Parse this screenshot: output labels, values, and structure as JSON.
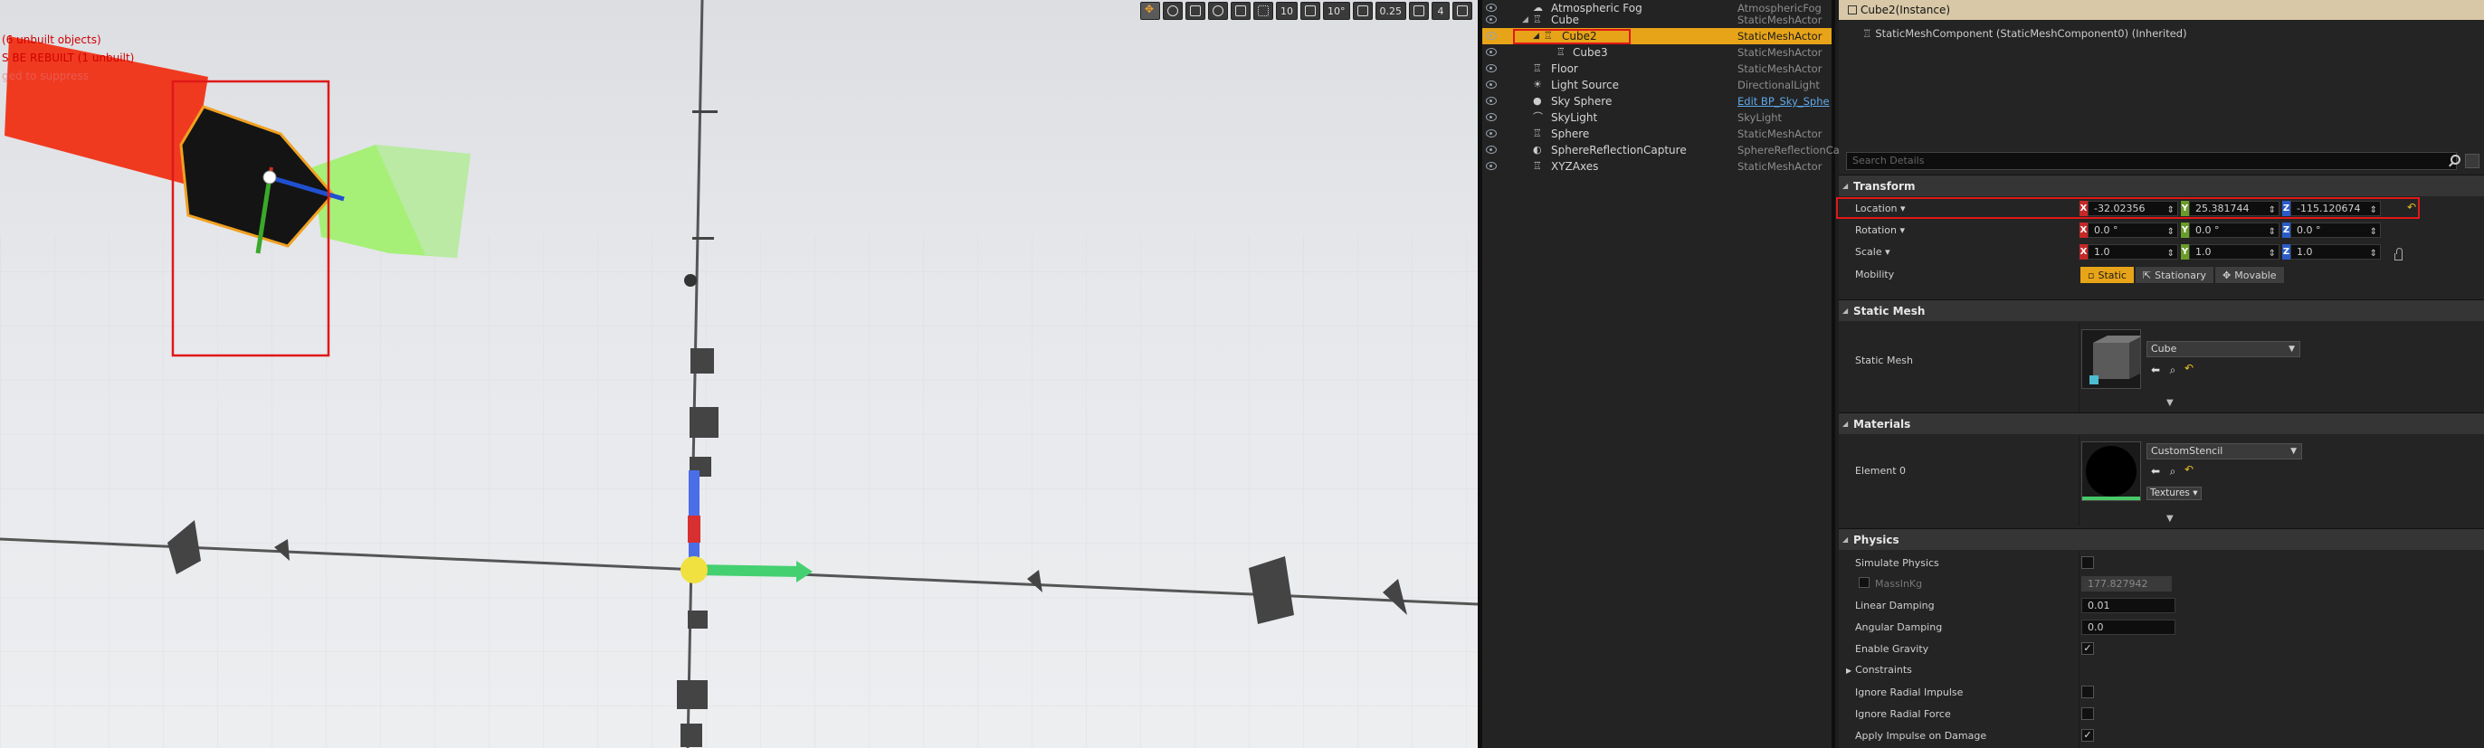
{
  "viewport": {
    "messages": {
      "unbuilt": "(6 unbuilt objects)",
      "rebuild": "S BE REBUILT (1 unbuilt)",
      "suppress": "ged to suppress"
    },
    "toolbar": {
      "grid_snap": "10",
      "rotation_snap": "10°",
      "scale_snap": "0.25",
      "camera_speed": "4"
    }
  },
  "outliner": {
    "rows": [
      {
        "name": "Atmospheric Fog",
        "type": "AtmosphericFog",
        "icon": "fog-icon"
      },
      {
        "name": "Cube",
        "type": "StaticMeshActor",
        "icon": "actor-icon"
      },
      {
        "name": "Cube2",
        "type": "StaticMeshActor",
        "icon": "actor-icon",
        "selected": true
      },
      {
        "name": "Cube3",
        "type": "StaticMeshActor",
        "icon": "actor-icon"
      },
      {
        "name": "Floor",
        "type": "StaticMeshActor",
        "icon": "actor-icon"
      },
      {
        "name": "Light Source",
        "type": "DirectionalLight",
        "icon": "sun-icon"
      },
      {
        "name": "Sky Sphere",
        "type": "Edit BP_Sky_Sphe",
        "icon": "sphere-icon",
        "link": true
      },
      {
        "name": "SkyLight",
        "type": "SkyLight",
        "icon": "skylight-icon"
      },
      {
        "name": "Sphere",
        "type": "StaticMeshActor",
        "icon": "actor-icon"
      },
      {
        "name": "SphereReflectionCapture",
        "type": "SphereReflectionCa",
        "icon": "reflection-icon"
      },
      {
        "name": "XYZAxes",
        "type": "StaticMeshActor",
        "icon": "actor-icon"
      }
    ]
  },
  "details": {
    "header": "Cube2(Instance)",
    "component": "StaticMeshComponent (StaticMeshComponent0) (Inherited)",
    "search_placeholder": "Search Details",
    "transform": {
      "title": "Transform",
      "location_label": "Location",
      "location": {
        "x": "-32.02356",
        "y": "25.381744",
        "z": "-115.120674"
      },
      "rotation_label": "Rotation",
      "rotation": {
        "x": "0.0 °",
        "y": "0.0 °",
        "z": "0.0 °"
      },
      "scale_label": "Scale",
      "scale": {
        "x": "1.0",
        "y": "1.0",
        "z": "1.0"
      },
      "mobility_label": "Mobility",
      "mobility_options": [
        "Static",
        "Stationary",
        "Movable"
      ]
    },
    "static_mesh": {
      "title": "Static Mesh",
      "label": "Static Mesh",
      "value": "Cube"
    },
    "materials": {
      "title": "Materials",
      "label": "Element 0",
      "value": "CustomStencil",
      "textures_label": "Textures"
    },
    "physics": {
      "title": "Physics",
      "simulate_label": "Simulate Physics",
      "mass_label": "MassInKg",
      "mass_value": "177.827942",
      "linear_damping_label": "Linear Damping",
      "linear_damping": "0.01",
      "angular_damping_label": "Angular Damping",
      "angular_damping": "0.0",
      "gravity_label": "Enable Gravity",
      "constraints_label": "Constraints",
      "radial_impulse_label": "Ignore Radial Impulse",
      "radial_force_label": "Ignore Radial Force",
      "apply_impulse_label": "Apply Impulse on Damage"
    },
    "colors": {
      "selected": "#e8a418",
      "highlight": "#e01818"
    }
  }
}
